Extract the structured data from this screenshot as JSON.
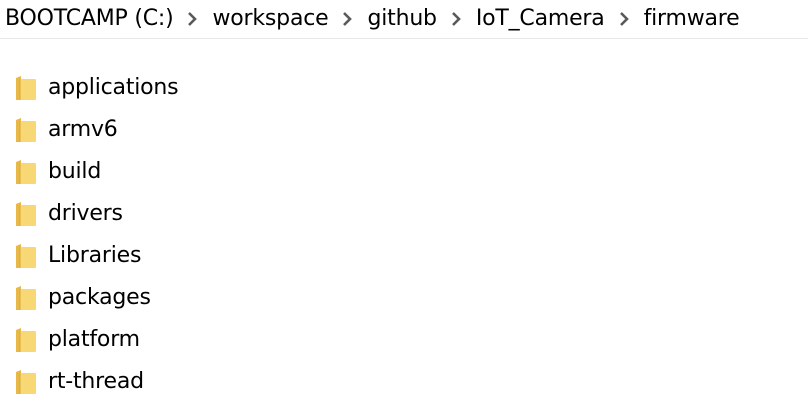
{
  "breadcrumb": [
    {
      "label": "BOOTCAMP (C:)"
    },
    {
      "label": "workspace"
    },
    {
      "label": "github"
    },
    {
      "label": "IoT_Camera"
    },
    {
      "label": "firmware"
    }
  ],
  "folders": [
    {
      "name": "applications",
      "icon": "folder-icon"
    },
    {
      "name": "armv6",
      "icon": "folder-icon"
    },
    {
      "name": "build",
      "icon": "folder-icon"
    },
    {
      "name": "drivers",
      "icon": "folder-icon"
    },
    {
      "name": "Libraries",
      "icon": "folder-icon"
    },
    {
      "name": "packages",
      "icon": "folder-icon"
    },
    {
      "name": "platform",
      "icon": "folder-icon"
    },
    {
      "name": "rt-thread",
      "icon": "folder-icon"
    }
  ],
  "colors": {
    "folder_fill": "#F8D775",
    "folder_back": "#E8B848",
    "separator": "#595959"
  }
}
